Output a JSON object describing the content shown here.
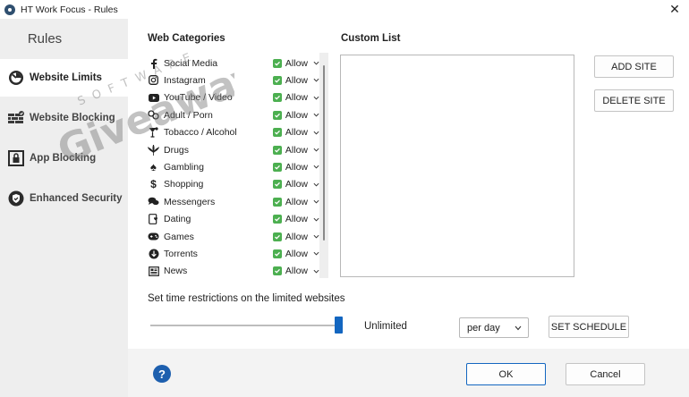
{
  "window": {
    "title": "HT Work Focus - Rules",
    "close_label": "✕"
  },
  "sidebar": {
    "title": "Rules",
    "items": [
      {
        "label": "Website Limits",
        "icon": "gauge-icon",
        "active": true
      },
      {
        "label": "Website Blocking",
        "icon": "wall-icon",
        "active": false
      },
      {
        "label": "App Blocking",
        "icon": "lock-screen-icon",
        "active": false
      },
      {
        "label": "Enhanced Security",
        "icon": "shield-check-icon",
        "active": false
      }
    ]
  },
  "web_categories": {
    "heading": "Web Categories",
    "items": [
      {
        "label": "Social Media",
        "icon": "facebook-icon",
        "status": "Allow"
      },
      {
        "label": "Instagram",
        "icon": "instagram-icon",
        "status": "Allow"
      },
      {
        "label": "YouTube / Video",
        "icon": "youtube-icon",
        "status": "Allow"
      },
      {
        "label": "Adult / Porn",
        "icon": "adult-icon",
        "status": "Allow"
      },
      {
        "label": "Tobacco / Alcohol",
        "icon": "cocktail-icon",
        "status": "Allow"
      },
      {
        "label": "Drugs",
        "icon": "leaf-icon",
        "status": "Allow"
      },
      {
        "label": "Gambling",
        "icon": "spade-icon",
        "status": "Allow"
      },
      {
        "label": "Shopping",
        "icon": "dollar-icon",
        "status": "Allow"
      },
      {
        "label": "Messengers",
        "icon": "chat-icon",
        "status": "Allow"
      },
      {
        "label": "Dating",
        "icon": "dating-icon",
        "status": "Allow"
      },
      {
        "label": "Games",
        "icon": "gamepad-icon",
        "status": "Allow"
      },
      {
        "label": "Torrents",
        "icon": "torrent-icon",
        "status": "Allow"
      },
      {
        "label": "News",
        "icon": "newspaper-icon",
        "status": "Allow"
      }
    ]
  },
  "custom_list": {
    "heading": "Custom List",
    "add_label": "ADD SITE",
    "delete_label": "DELETE SITE"
  },
  "time_restrictions": {
    "label": "Set time restrictions on the limited websites",
    "slider_value_label": "Unlimited",
    "slider_fraction": 1.0,
    "period": "per day",
    "schedule_label": "SET SCHEDULE"
  },
  "footer": {
    "help_label": "?",
    "ok_label": "OK",
    "cancel_label": "Cancel"
  },
  "watermark": {
    "main": "Giveaway",
    "sub": "SOFTWARE"
  },
  "colors": {
    "accent": "#1366c0",
    "check": "#4caf50",
    "sidebar_bg": "#eeeeee"
  }
}
